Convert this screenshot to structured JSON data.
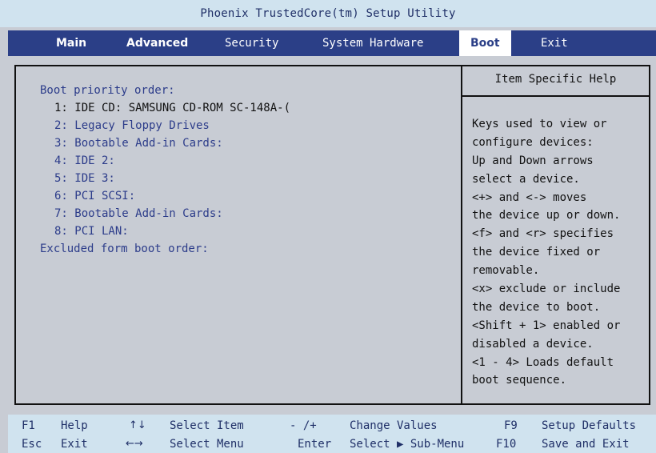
{
  "window": {
    "title": "Phoenix TrustedCore(tm) Setup Utility"
  },
  "menu": {
    "tabs": [
      {
        "label": "Main"
      },
      {
        "label": "Advanced"
      },
      {
        "label": "Security"
      },
      {
        "label": "System Hardware"
      },
      {
        "label": "Boot"
      },
      {
        "label": "Exit"
      }
    ],
    "active_tab": "Boot"
  },
  "boot": {
    "priority_header": "Boot priority order:",
    "items": [
      "1: IDE CD:  SAMSUNG CD-ROM SC-148A-(",
      "2: Legacy Floppy Drives",
      "3: Bootable Add-in Cards:",
      "4: IDE 2:",
      "5: IDE 3:",
      "6: PCI SCSI:",
      "7: Bootable Add-in Cards:",
      "8: PCI LAN:"
    ],
    "excluded_header": "Excluded form boot order:"
  },
  "help": {
    "title": "Item Specific Help",
    "lines": [
      "Keys used to view or",
      "configure devices:",
      "Up and Down arrows",
      "select a device.",
      "<+> and <-> moves",
      "the device up or down.",
      "<f> and <r> specifies",
      "the device fixed or",
      "removable.",
      "<x> exclude or include",
      "the device to boot.",
      "<Shift + 1> enabled or",
      "disabled a device.",
      "<1 - 4> Loads default",
      "boot sequence."
    ]
  },
  "footer": {
    "f1_key": "F1",
    "f1_label": "Help",
    "updown_key": "↑↓",
    "updown_label": "Select Item",
    "minusplus_key": "- /+",
    "minusplus_label": "Change Values",
    "f9_key": "F9",
    "f9_label": "Setup Defaults",
    "esc_key": "Esc",
    "esc_label": "Exit",
    "leftright_key": "←→",
    "leftright_label": "Select Menu",
    "enter_key": "Enter",
    "enter_label": "Select ▶ Sub-Menu",
    "f10_key": "F10",
    "f10_label": "Save and Exit"
  },
  "colors": {
    "menubar": "#2b3f87",
    "background": "#c8ccd4",
    "titlebar": "#d0e3ef",
    "item_text": "#2c3c8a",
    "selected_text": "#111111"
  }
}
